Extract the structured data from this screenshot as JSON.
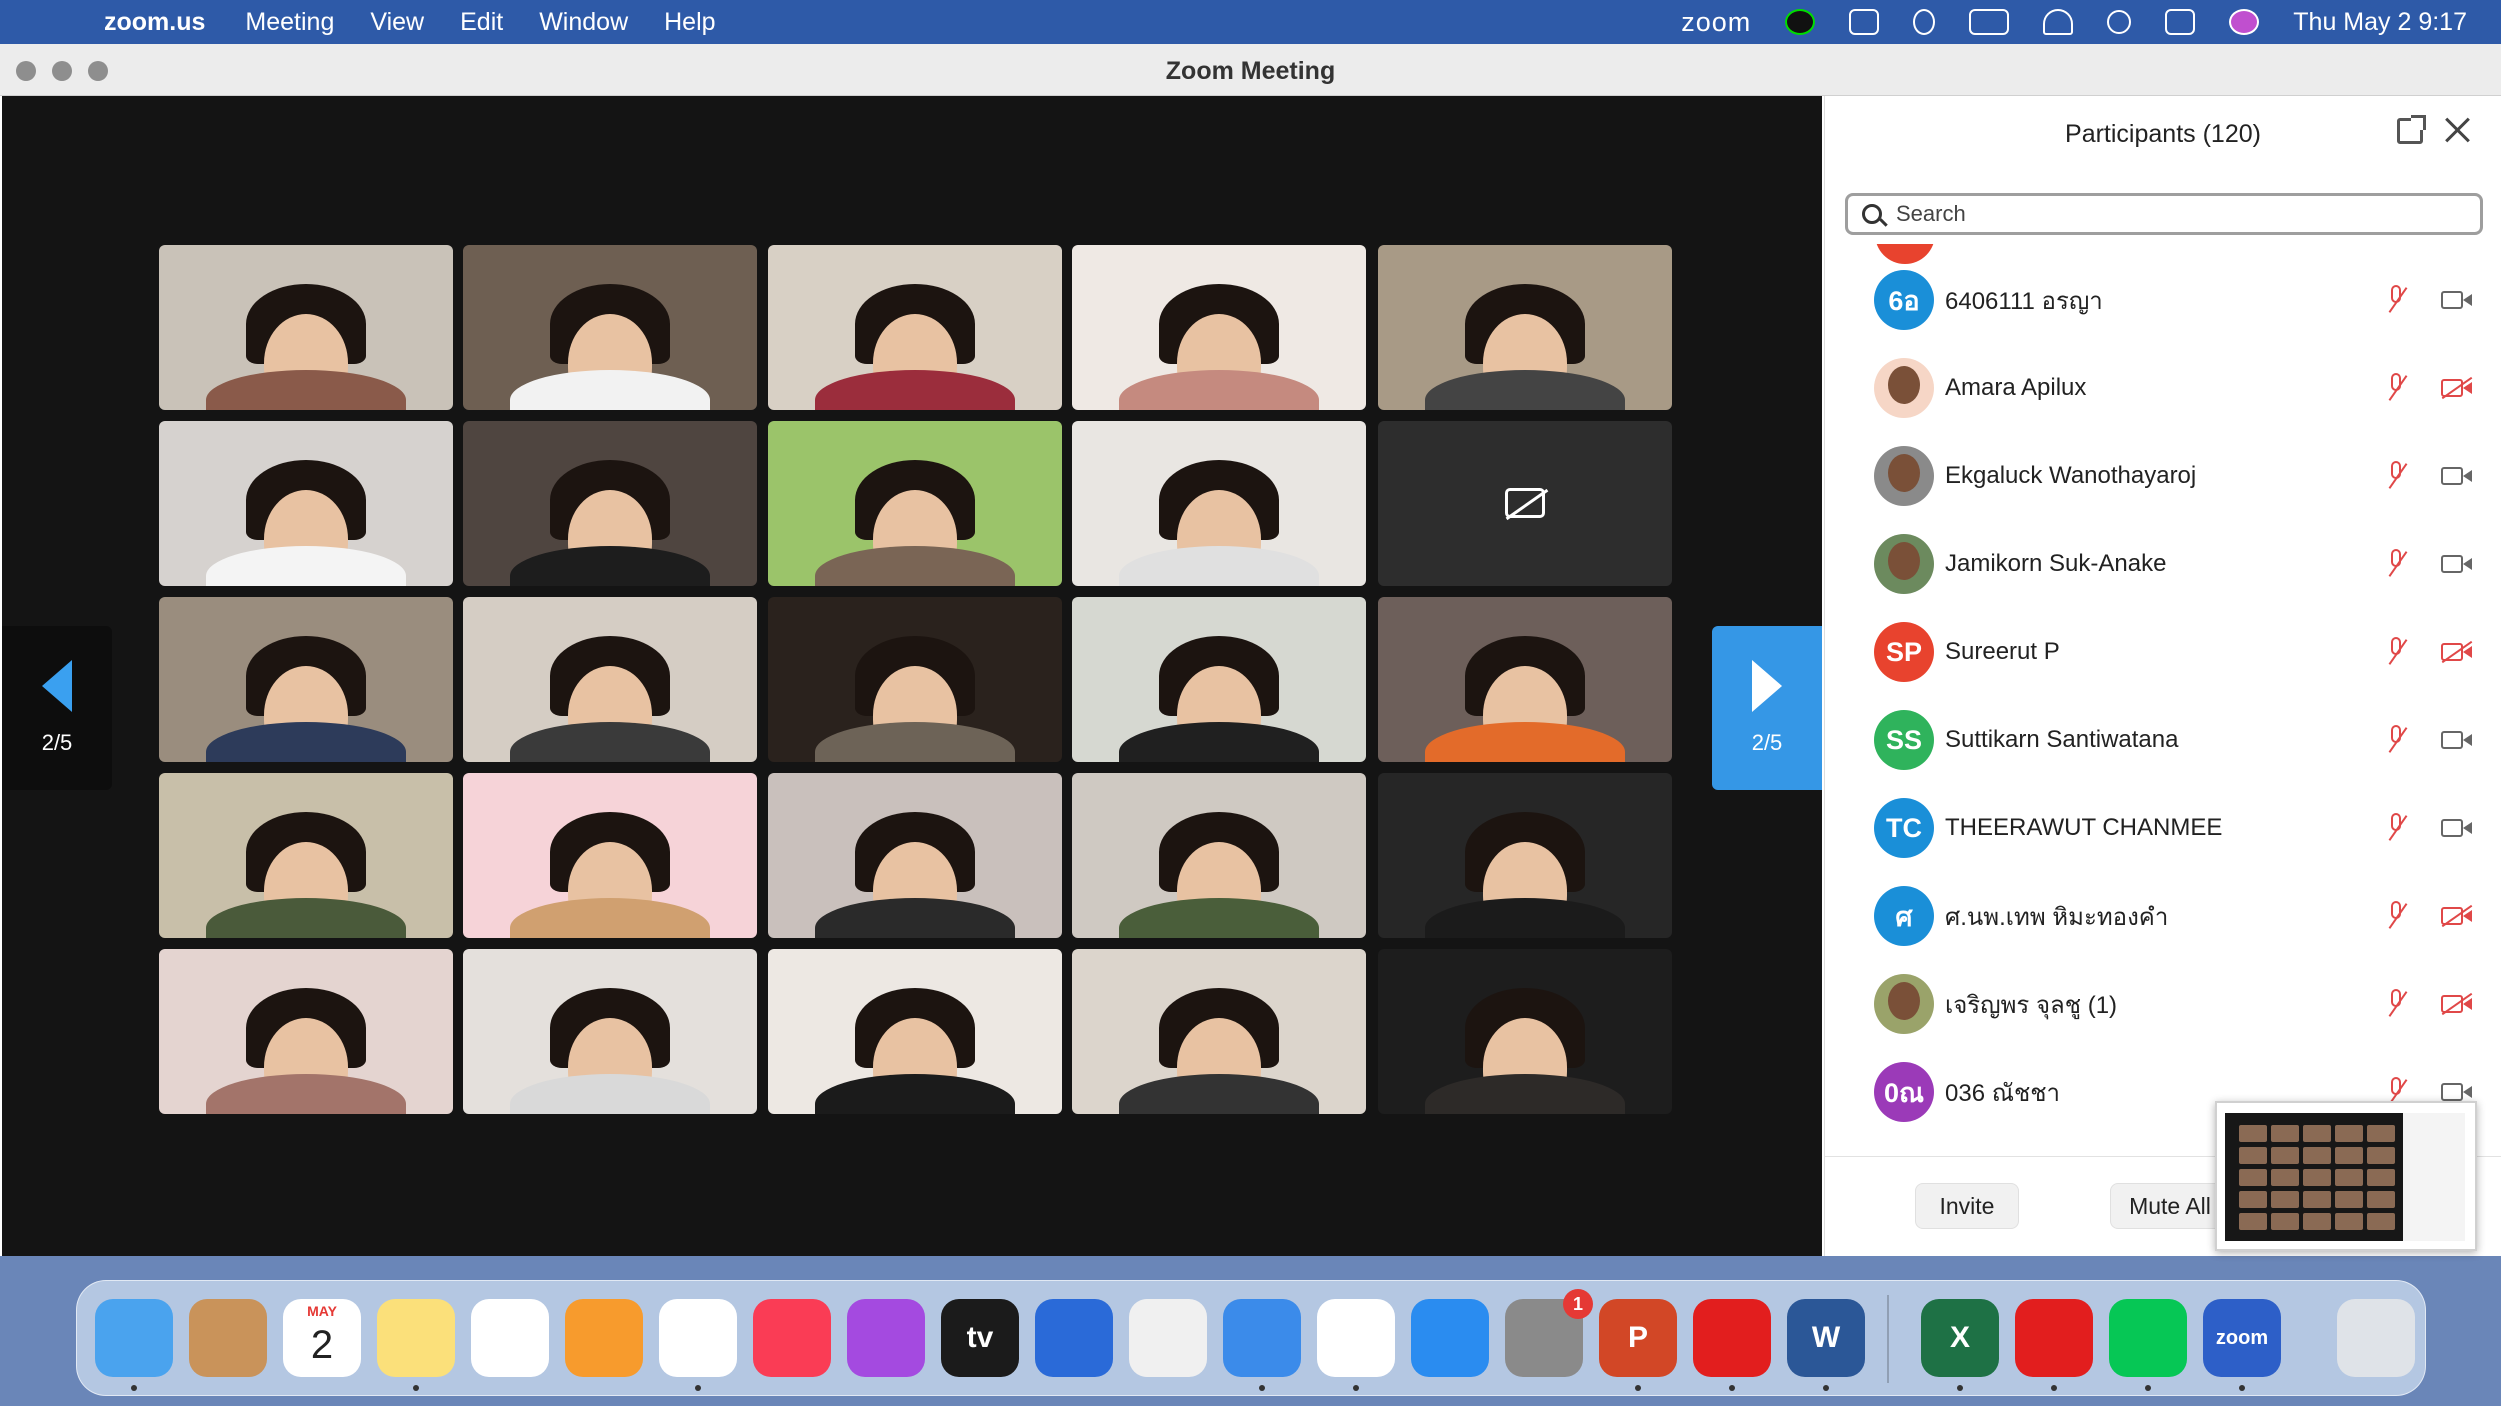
{
  "menubar": {
    "app_name": "zoom.us",
    "menus": [
      "Meeting",
      "View",
      "Edit",
      "Window",
      "Help"
    ],
    "zoom_logo": "zoom",
    "clock": "Thu May 2  9:17"
  },
  "window": {
    "title": "Zoom Meeting"
  },
  "gallery": {
    "page_indicator_prev": "2/5",
    "page_indicator_next": "2/5"
  },
  "participants": {
    "title": "Participants (120)",
    "search_placeholder": "Search",
    "list": [
      {
        "initials": "6อ",
        "name": "6406111 อรญา",
        "avatar_color": "#1a8fd8",
        "photo": false,
        "video_off": false
      },
      {
        "initials": "",
        "name": "Amara Apilux",
        "avatar_color": "#f6d6c6",
        "photo": true,
        "video_off": true
      },
      {
        "initials": "",
        "name": "Ekgaluck Wanothayaroj",
        "avatar_color": "#8a8a8a",
        "photo": true,
        "video_off": false
      },
      {
        "initials": "",
        "name": "Jamikorn Suk-Anake",
        "avatar_color": "#6c8a5e",
        "photo": true,
        "video_off": false
      },
      {
        "initials": "SP",
        "name": "Sureerut P",
        "avatar_color": "#e8432e",
        "photo": false,
        "video_off": true
      },
      {
        "initials": "SS",
        "name": "Suttikarn Santiwatana",
        "avatar_color": "#2fb35c",
        "photo": false,
        "video_off": false
      },
      {
        "initials": "TC",
        "name": "THEERAWUT CHANMEE",
        "avatar_color": "#1a8fd8",
        "photo": false,
        "video_off": false
      },
      {
        "initials": "ศ",
        "name": "ศ.นพ.เทพ หิมะทองคำ",
        "avatar_color": "#1a8fd8",
        "photo": false,
        "video_off": true
      },
      {
        "initials": "",
        "name": "เจริญพร จุลชู (1)",
        "avatar_color": "#9aa36a",
        "photo": true,
        "video_off": true
      },
      {
        "initials": "0ณ",
        "name": "036 ณัชชา",
        "avatar_color": "#9b3ab8",
        "photo": false,
        "video_off": false
      }
    ],
    "invite_label": "Invite",
    "mute_all_label": "Mute All"
  },
  "colors": {
    "zoom_blue": "#2d8cff",
    "muted_red": "#e04848",
    "menubar": "#2e5aa8"
  },
  "dock": {
    "calendar_month": "MAY",
    "calendar_day": "2",
    "settings_badge": "1",
    "apps": [
      "finder",
      "contacts",
      "calendar",
      "notes",
      "news",
      "books",
      "photos",
      "music",
      "podcasts",
      "tv",
      "craft",
      "pages",
      "safari",
      "numbers",
      "app-store",
      "system-preferences",
      "powerpoint",
      "acrobat",
      "word",
      "excel",
      "acrobat-reader",
      "line-app",
      "zoom",
      "trash"
    ],
    "app_texts": {
      "tv": "tv",
      "powerpoint": "P",
      "word": "W",
      "excel": "X",
      "zoom": "zoom"
    }
  }
}
